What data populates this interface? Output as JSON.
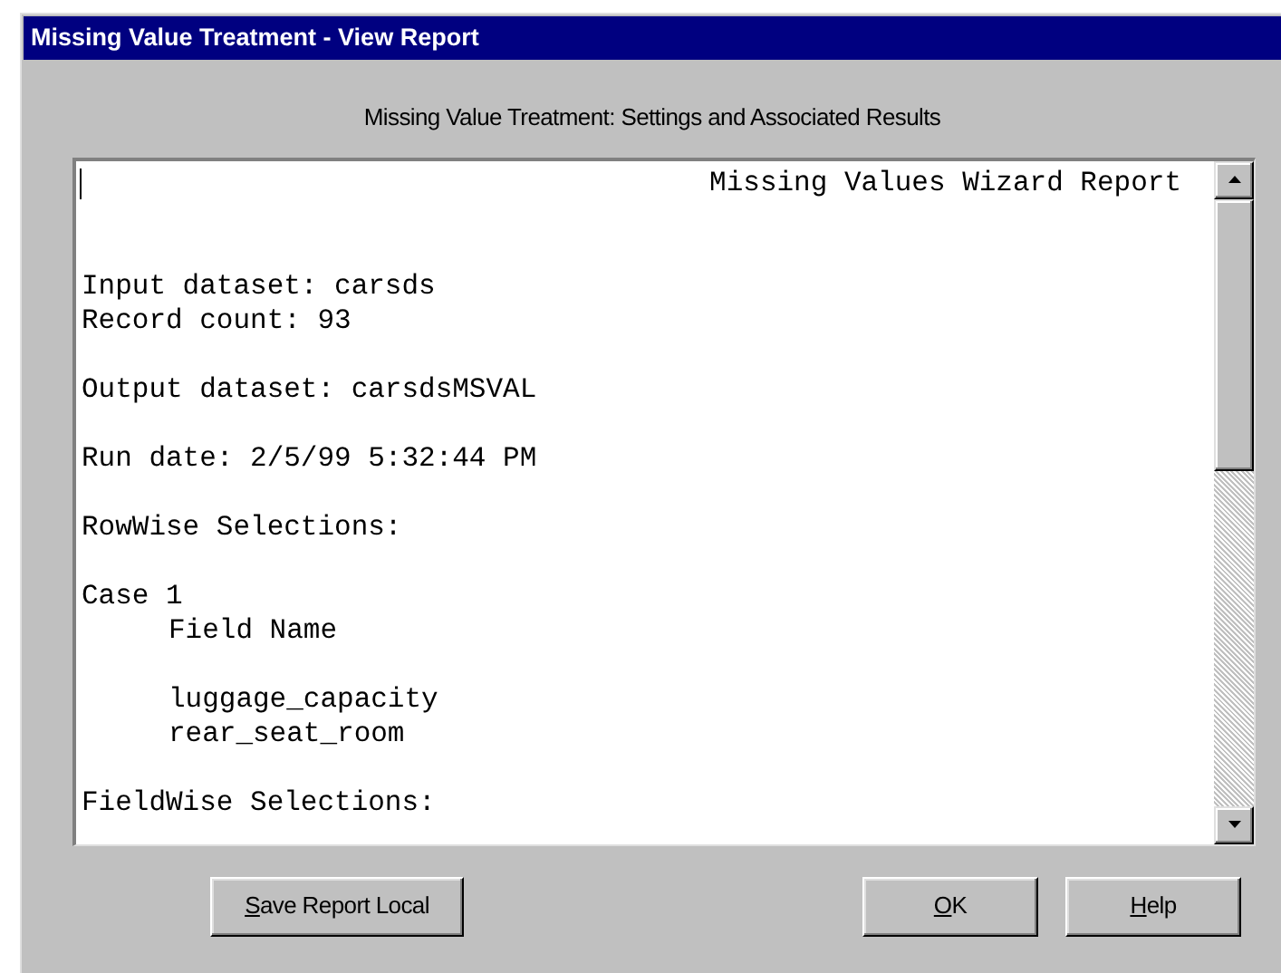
{
  "window": {
    "title": "Missing Value Treatment - View Report"
  },
  "heading": "Missing Value Treatment:  Settings and Associated Results",
  "report": {
    "lines": [
      {
        "kind": "title",
        "text": "Missing Values Wizard Report"
      },
      {
        "kind": "blank"
      },
      {
        "kind": "blank"
      },
      {
        "kind": "text",
        "text": "Input dataset: carsds"
      },
      {
        "kind": "text",
        "text": "Record count: 93"
      },
      {
        "kind": "blank"
      },
      {
        "kind": "text",
        "text": "Output dataset: carsdsMSVAL"
      },
      {
        "kind": "blank"
      },
      {
        "kind": "text",
        "text": "Run date: 2/5/99 5:32:44 PM"
      },
      {
        "kind": "blank"
      },
      {
        "kind": "text",
        "text": "RowWise Selections:"
      },
      {
        "kind": "blank"
      },
      {
        "kind": "text",
        "text": "Case 1",
        "children": [
          {
            "kind": "text",
            "text": "Field Name"
          },
          {
            "kind": "blank"
          },
          {
            "kind": "text",
            "text": "luggage_capacity"
          },
          {
            "kind": "text",
            "text": "rear_seat_room"
          }
        ]
      },
      {
        "kind": "blank"
      },
      {
        "kind": "text",
        "text": "FieldWise Selections:"
      }
    ]
  },
  "buttons": [
    {
      "access_key": "S",
      "rest": "ave Report Local"
    },
    {
      "access_key": "O",
      "rest": "K"
    },
    {
      "access_key": "H",
      "rest": "elp"
    }
  ]
}
